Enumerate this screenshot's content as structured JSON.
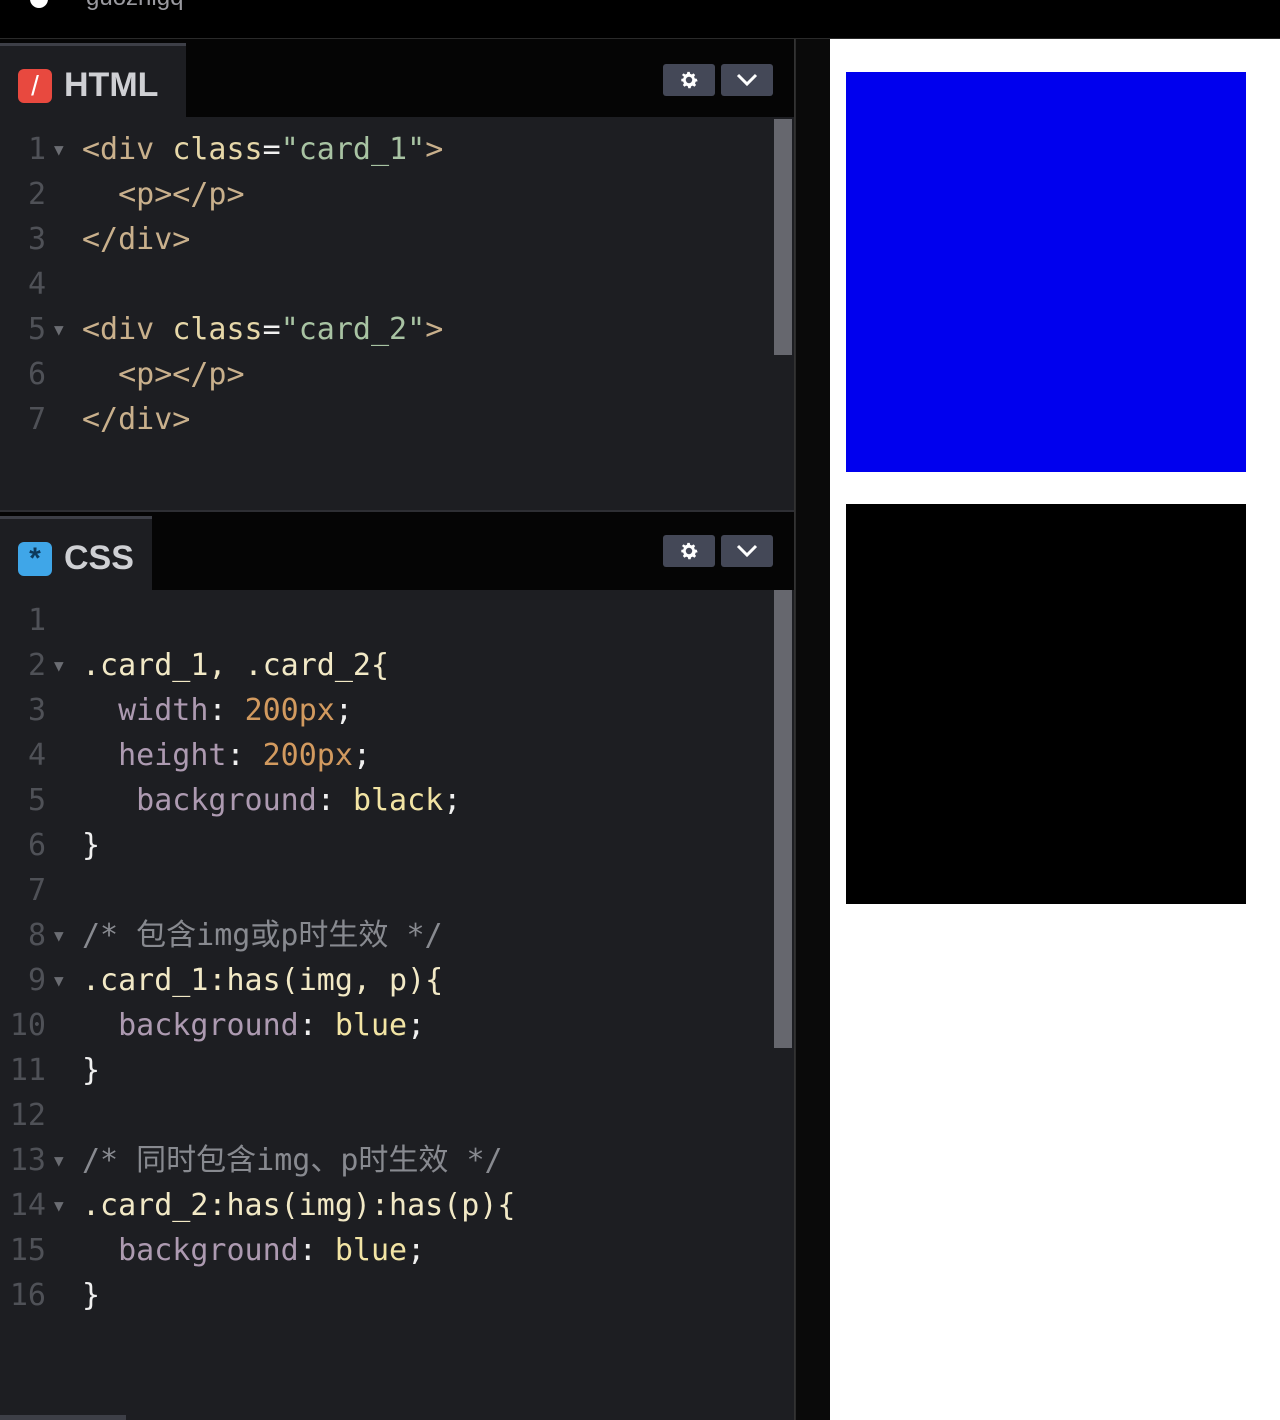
{
  "header": {
    "username": "guozhigq"
  },
  "html_panel": {
    "title": "HTML",
    "badge": "/",
    "lines": [
      {
        "n": "1",
        "fold": true,
        "parts": [
          [
            "t-tag",
            "<div "
          ],
          [
            "t-attr",
            "class"
          ],
          [
            "t-pun",
            "="
          ],
          [
            "t-str",
            "\"card_1\""
          ],
          [
            "t-tag",
            ">"
          ]
        ]
      },
      {
        "n": "2",
        "fold": false,
        "parts": [
          [
            "t-tag",
            "  <p></p>"
          ]
        ]
      },
      {
        "n": "3",
        "fold": false,
        "parts": [
          [
            "t-tag",
            "</div>"
          ]
        ]
      },
      {
        "n": "4",
        "fold": false,
        "parts": []
      },
      {
        "n": "5",
        "fold": true,
        "parts": [
          [
            "t-tag",
            "<div "
          ],
          [
            "t-attr",
            "class"
          ],
          [
            "t-pun",
            "="
          ],
          [
            "t-str",
            "\"card_2\""
          ],
          [
            "t-tag",
            ">"
          ]
        ]
      },
      {
        "n": "6",
        "fold": false,
        "parts": [
          [
            "t-tag",
            "  <p></p>"
          ]
        ]
      },
      {
        "n": "7",
        "fold": false,
        "parts": [
          [
            "t-tag",
            "</div>"
          ]
        ]
      }
    ]
  },
  "css_panel": {
    "title": "CSS",
    "badge": "*",
    "lines": [
      {
        "n": "1",
        "fold": false,
        "parts": []
      },
      {
        "n": "2",
        "fold": true,
        "parts": [
          [
            "t-sel",
            ".card_1, .card_2{"
          ]
        ]
      },
      {
        "n": "3",
        "fold": false,
        "parts": [
          [
            "t-prop",
            "  width"
          ],
          [
            "t-pun",
            ": "
          ],
          [
            "t-num",
            "200px"
          ],
          [
            "t-pun",
            ";"
          ]
        ]
      },
      {
        "n": "4",
        "fold": false,
        "parts": [
          [
            "t-prop",
            "  height"
          ],
          [
            "t-pun",
            ": "
          ],
          [
            "t-num",
            "200px"
          ],
          [
            "t-pun",
            ";"
          ]
        ]
      },
      {
        "n": "5",
        "fold": false,
        "parts": [
          [
            "t-prop",
            "   background"
          ],
          [
            "t-pun",
            ": "
          ],
          [
            "t-val",
            "black"
          ],
          [
            "t-pun",
            ";"
          ]
        ]
      },
      {
        "n": "6",
        "fold": false,
        "parts": [
          [
            "t-pun",
            "}"
          ]
        ]
      },
      {
        "n": "7",
        "fold": false,
        "parts": []
      },
      {
        "n": "8",
        "fold": true,
        "parts": [
          [
            "t-com",
            "/* 包含img或p时生效 */"
          ]
        ]
      },
      {
        "n": "9",
        "fold": true,
        "parts": [
          [
            "t-sel",
            ".card_1:has(img, p){"
          ]
        ]
      },
      {
        "n": "10",
        "fold": false,
        "parts": [
          [
            "t-prop",
            "  background"
          ],
          [
            "t-pun",
            ": "
          ],
          [
            "t-val",
            "blue"
          ],
          [
            "t-pun",
            ";"
          ]
        ]
      },
      {
        "n": "11",
        "fold": false,
        "parts": [
          [
            "t-pun",
            "}"
          ]
        ]
      },
      {
        "n": "12",
        "fold": false,
        "parts": []
      },
      {
        "n": "13",
        "fold": true,
        "parts": [
          [
            "t-com",
            "/* 同时包含img、p时生效 */"
          ]
        ]
      },
      {
        "n": "14",
        "fold": true,
        "parts": [
          [
            "t-sel",
            ".card_2:has(img):has(p){"
          ]
        ]
      },
      {
        "n": "15",
        "fold": false,
        "parts": [
          [
            "t-prop",
            "  background"
          ],
          [
            "t-pun",
            ": "
          ],
          [
            "t-val",
            "blue"
          ],
          [
            "t-pun",
            ";"
          ]
        ]
      },
      {
        "n": "16",
        "fold": false,
        "parts": [
          [
            "t-pun",
            "}"
          ]
        ]
      }
    ]
  },
  "preview": {
    "card_1_color": "#0000ee",
    "card_2_color": "#000000"
  },
  "icons": {
    "settings": "gear-icon",
    "collapse": "chevron-down-icon"
  },
  "colors": {
    "html_badge": "#e8493f",
    "css_badge": "#3fa6e8",
    "editor_bg": "#1d1e22"
  }
}
